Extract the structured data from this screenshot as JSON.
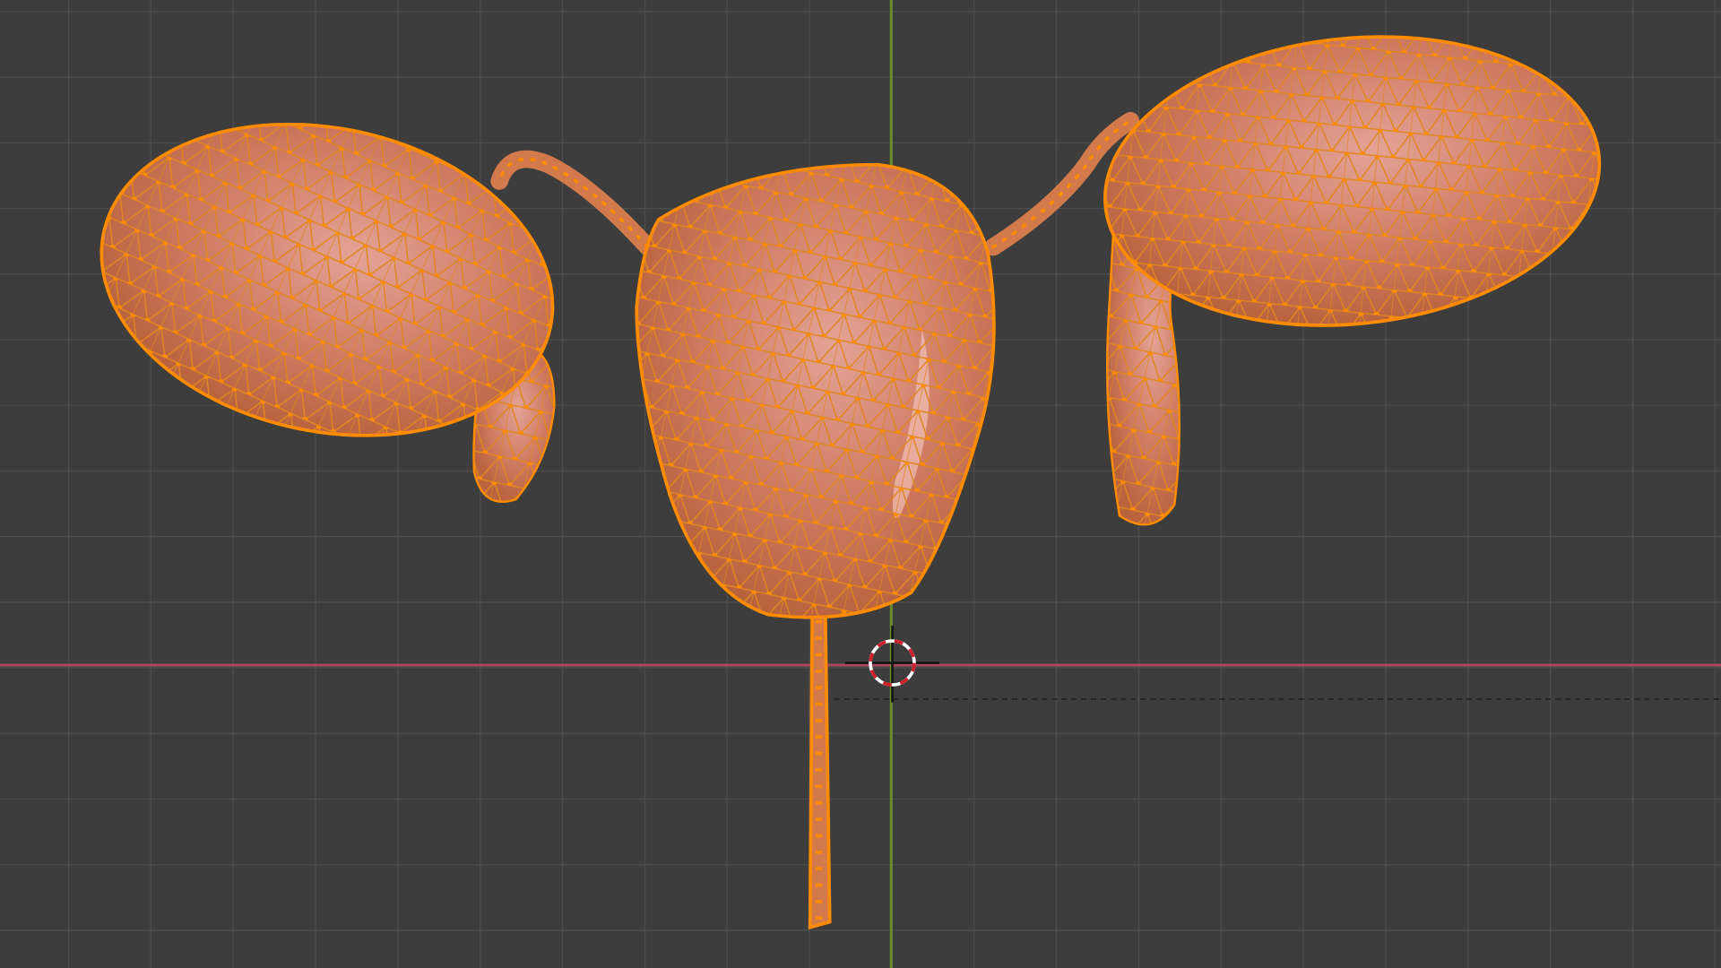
{
  "viewport": {
    "mode": "edit-mode",
    "colors": {
      "background": "#3d3d3d",
      "grid": "#4c4c4c",
      "x_axis": "#a8485c",
      "y_axis": "#6a8c2a",
      "mesh_fill": "#d9836a",
      "mesh_highlight": "#e8a79a",
      "wire": "#e8891c",
      "vertex": "#ff8c00"
    },
    "icons": [
      "3d-cursor-icon"
    ]
  }
}
